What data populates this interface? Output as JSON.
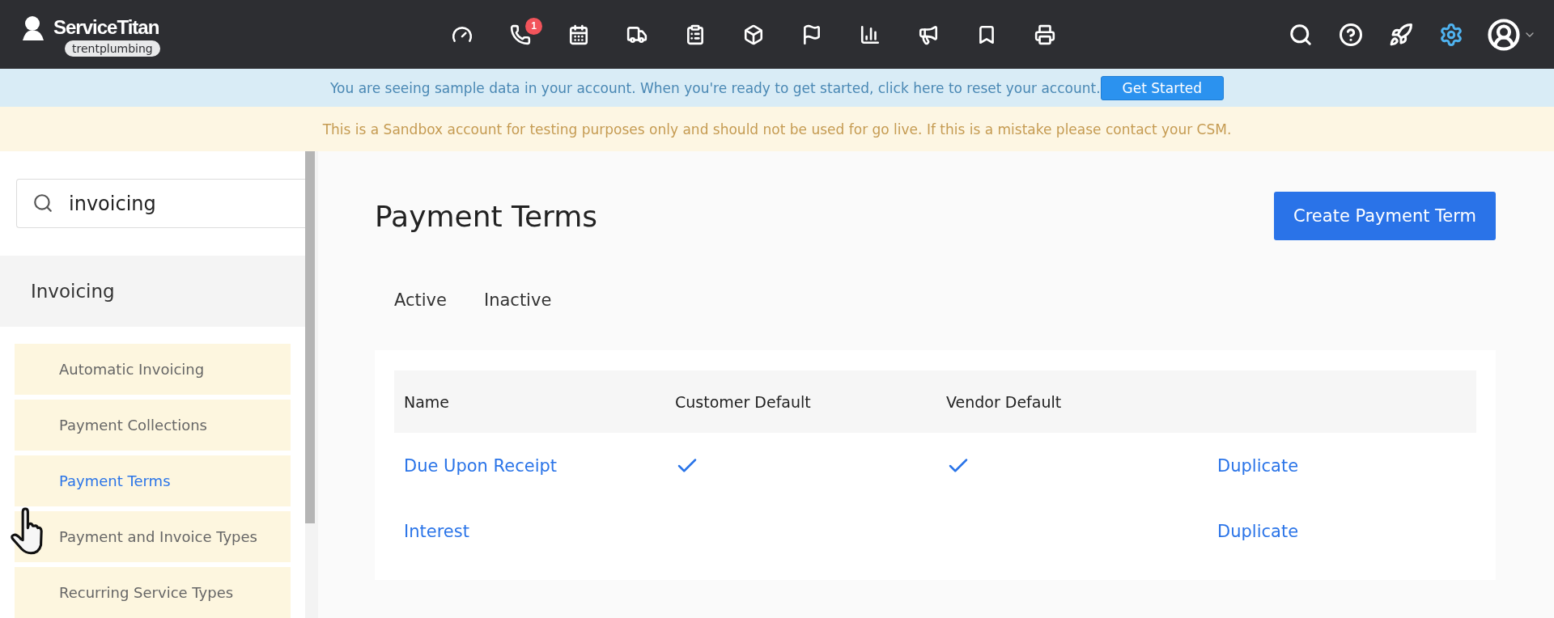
{
  "brand": {
    "name": "ServiceTitan",
    "account": "trentplumbing"
  },
  "nav_icons": [
    {
      "selected": false
    },
    {
      "selected": false,
      "badge": "1"
    },
    {
      "selected": false
    },
    {
      "selected": false
    },
    {
      "selected": false
    },
    {
      "selected": false
    },
    {
      "selected": false
    },
    {
      "selected": false
    },
    {
      "selected": false
    },
    {
      "selected": false
    },
    {
      "selected": false
    }
  ],
  "tools": [
    {
      "selected": false
    },
    {
      "selected": false
    },
    {
      "selected": false
    },
    {
      "selected": true
    },
    {
      "selected": false
    }
  ],
  "sample_banner": {
    "text": "You are seeing sample data in your account. When you're ready to get started, click here to reset your account.",
    "button": "Get Started"
  },
  "sandbox_banner": {
    "text": "This is a Sandbox account for testing purposes only and should not be used for go live. If this is a mistake please contact your CSM."
  },
  "sidebar": {
    "search": {
      "value": "invoicing"
    },
    "section": "Invoicing",
    "items": [
      {
        "label": "Automatic Invoicing",
        "selected": false
      },
      {
        "label": "Payment Collections",
        "selected": false
      },
      {
        "label": "Payment Terms",
        "selected": true
      },
      {
        "label": "Payment and Invoice Types",
        "selected": false
      },
      {
        "label": "Recurring Service Types",
        "selected": false
      }
    ]
  },
  "page": {
    "title": "Payment Terms",
    "create_button": "Create Payment Term",
    "tabs": [
      {
        "label": "Active"
      },
      {
        "label": "Inactive"
      }
    ]
  },
  "table": {
    "columns": [
      "Name",
      "Customer Default",
      "Vendor Default"
    ],
    "rows": [
      {
        "name": "Due Upon Receipt",
        "customer_default": true,
        "vendor_default": true,
        "action": "Duplicate"
      },
      {
        "name": "Interest",
        "customer_default": false,
        "vendor_default": false,
        "action": "Duplicate"
      }
    ]
  }
}
